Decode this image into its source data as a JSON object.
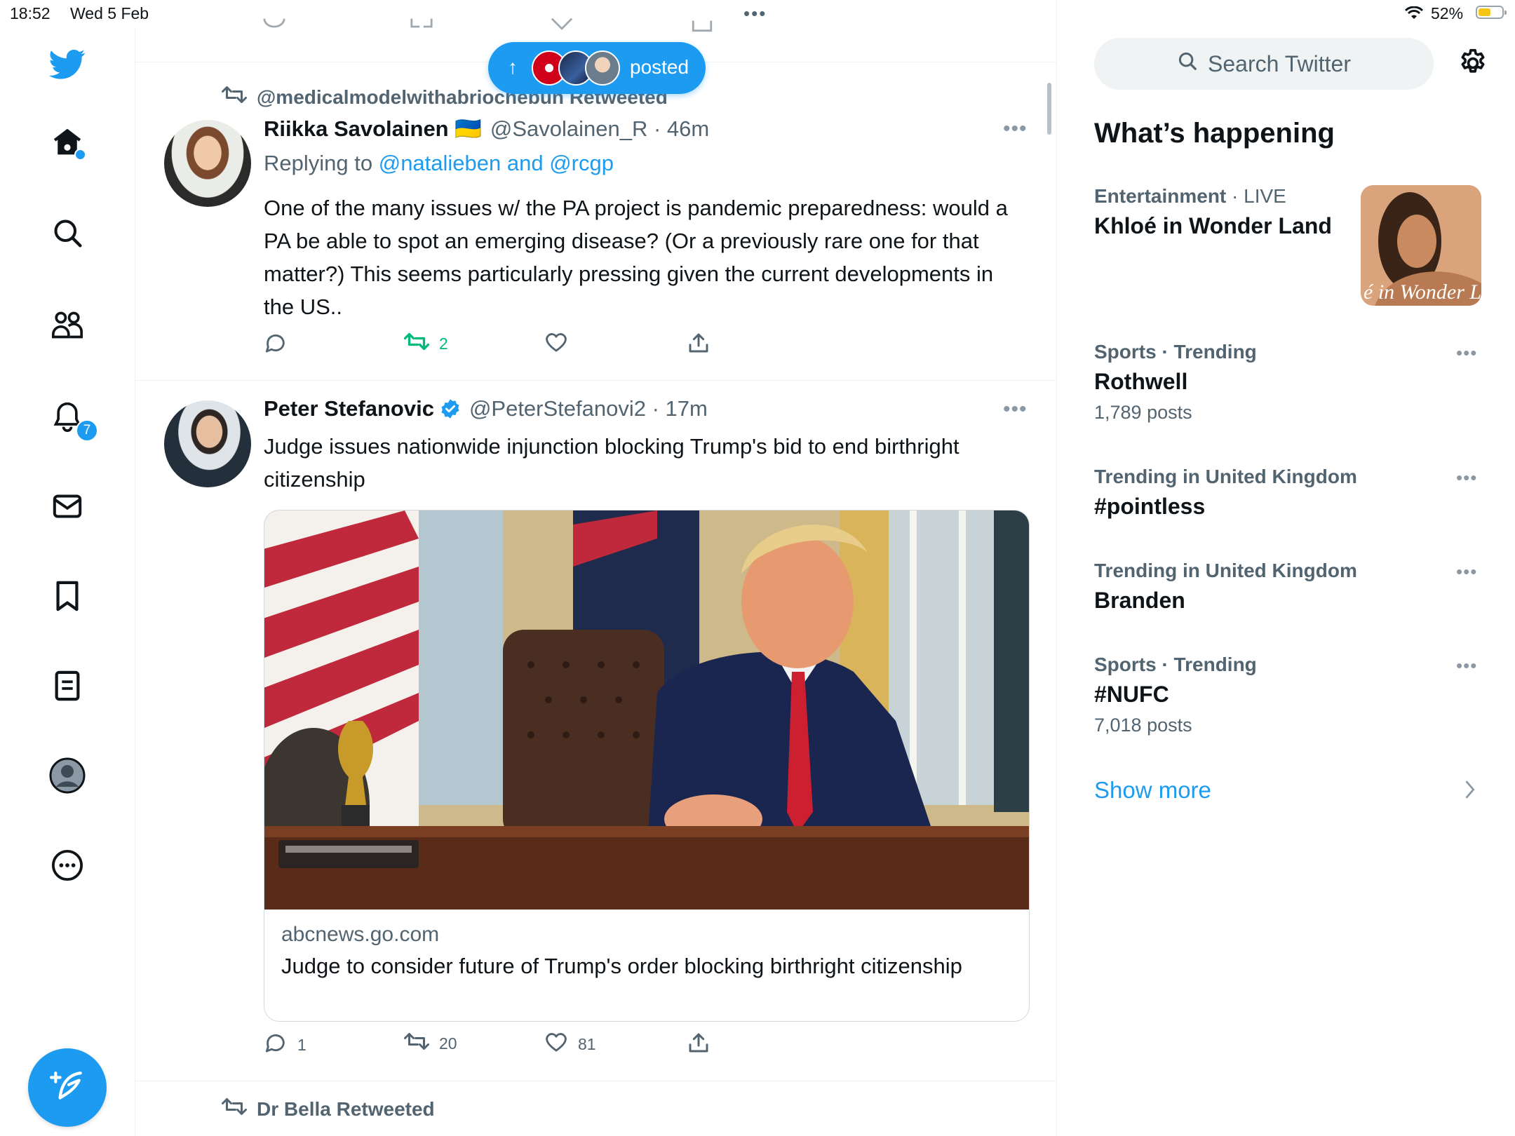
{
  "status_bar": {
    "time": "18:52",
    "date": "Wed 5 Feb",
    "multitask_dots": "•••",
    "battery_percent": "52%",
    "battery_level": 0.52
  },
  "rail": {
    "notifications_badge": "7",
    "icons": [
      "twitter-logo",
      "home-icon",
      "search-icon",
      "communities-icon",
      "notifications-icon",
      "messages-icon",
      "bookmarks-icon",
      "lists-icon",
      "profile-icon",
      "more-icon",
      "compose-icon"
    ]
  },
  "new_posts_pill": {
    "label": "posted"
  },
  "timeline": {
    "tweet1": {
      "retweeted_by": "@medicalmodelwithabriochebun Retweeted",
      "name": "Riikka Savolainen 🇺🇦",
      "handle_time": "@Savolainen_R · 46m",
      "replying_prefix": "Replying to ",
      "replying_users": "@natalieben and @rcgp",
      "text": "One of the many issues w/ the PA project is pandemic preparedness: would a PA be able to spot an emerging disease? (Or a previously rare one for that matter?) This seems particularly pressing given the current developments in the US..",
      "replies": "",
      "retweets": "2",
      "likes": ""
    },
    "tweet2": {
      "name": "Peter Stefanovic",
      "handle_time": "@PeterStefanovi2 · 17m",
      "text": "Judge issues nationwide injunction blocking Trump's bid to end birthright citizenship",
      "card_domain": "abcnews.go.com",
      "card_headline": "Judge to consider future of Trump's order blocking birthright citizenship",
      "replies": "1",
      "retweets": "20",
      "likes": "81"
    },
    "tweet3": {
      "retweeted_by": "Dr Bella Retweeted"
    }
  },
  "sidebar": {
    "search_placeholder": "Search Twitter",
    "section_title": "What’s happening",
    "trends": [
      {
        "meta_category": "Entertainment",
        "meta_extra": " · LIVE",
        "topic": "Khloé in Wonder Land",
        "count": ""
      },
      {
        "meta_category": "Sports · Trending",
        "meta_extra": "",
        "topic": "Rothwell",
        "count": "1,789 posts"
      },
      {
        "meta_category": "Trending in United Kingdom",
        "meta_extra": "",
        "topic": "#pointless",
        "count": ""
      },
      {
        "meta_category": "Trending in United Kingdom",
        "meta_extra": "",
        "topic": "Branden",
        "count": ""
      },
      {
        "meta_category": "Sports · Trending",
        "meta_extra": "",
        "topic": "#NUFC",
        "count": "7,018 posts"
      }
    ],
    "thumb_caption": "é in Wonder L",
    "show_more": "Show more"
  },
  "colors": {
    "accent": "#1d9bf0",
    "retweet_green": "#00ba7c",
    "secondary_text": "#536471",
    "border": "#eff3f4"
  }
}
